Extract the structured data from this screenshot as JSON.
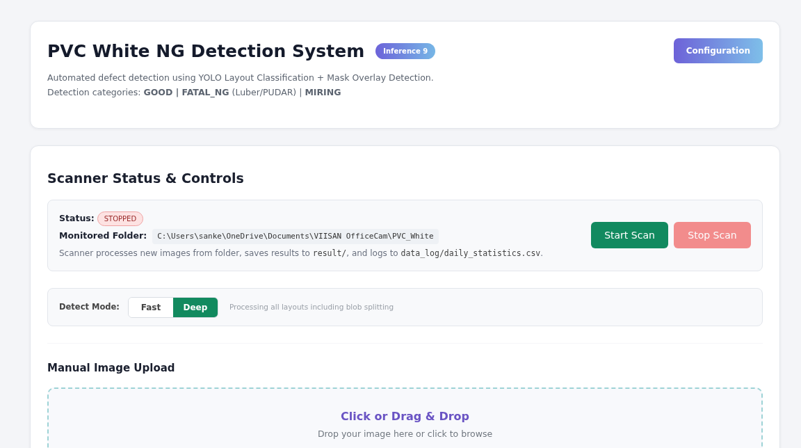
{
  "header": {
    "title": "PVC White NG Detection System",
    "badge": "Inference 9",
    "config_button": "Configuration",
    "description": [
      "Automated defect detection using YOLO Layout Classification + Mask Overlay Detection.",
      "Detection categories: **GOOD | FATAL_NG** (Luber/PUDAR) | **MIRING**"
    ]
  },
  "scanner": {
    "title": "Scanner Status & Controls",
    "status_label": "Status:",
    "status": "STOPPED",
    "folder_label": "Monitored Folder:",
    "folder": "C:\\Users\\sanke\\OneDrive\\Documents\\VIISAN OfficeCam\\PVC_White",
    "note": [
      {
        "kind": "text",
        "text": "Scanner processes new images from folder, saves results to "
      },
      {
        "kind": "code",
        "text": "result/"
      },
      {
        "kind": "text",
        "text": ", and logs to "
      },
      {
        "kind": "code",
        "text": "data_log/daily_statistics.csv"
      },
      {
        "kind": "text",
        "text": "."
      }
    ],
    "buttons": [
      {
        "label": "Start Scan",
        "kind": "start",
        "disabled": false
      },
      {
        "label": "Stop Scan",
        "kind": "stop",
        "disabled": true
      }
    ]
  },
  "detect_mode": {
    "label": "Detect Mode:",
    "options": [
      {
        "label": "Fast",
        "selected": false
      },
      {
        "label": "Deep",
        "selected": true
      }
    ],
    "hint": "Processing all layouts including blob splitting"
  },
  "upload": {
    "title": "Manual Image Upload",
    "drop_title": "Click or Drag & Drop",
    "drop_hint": "Drop your image here or click to browse"
  }
}
